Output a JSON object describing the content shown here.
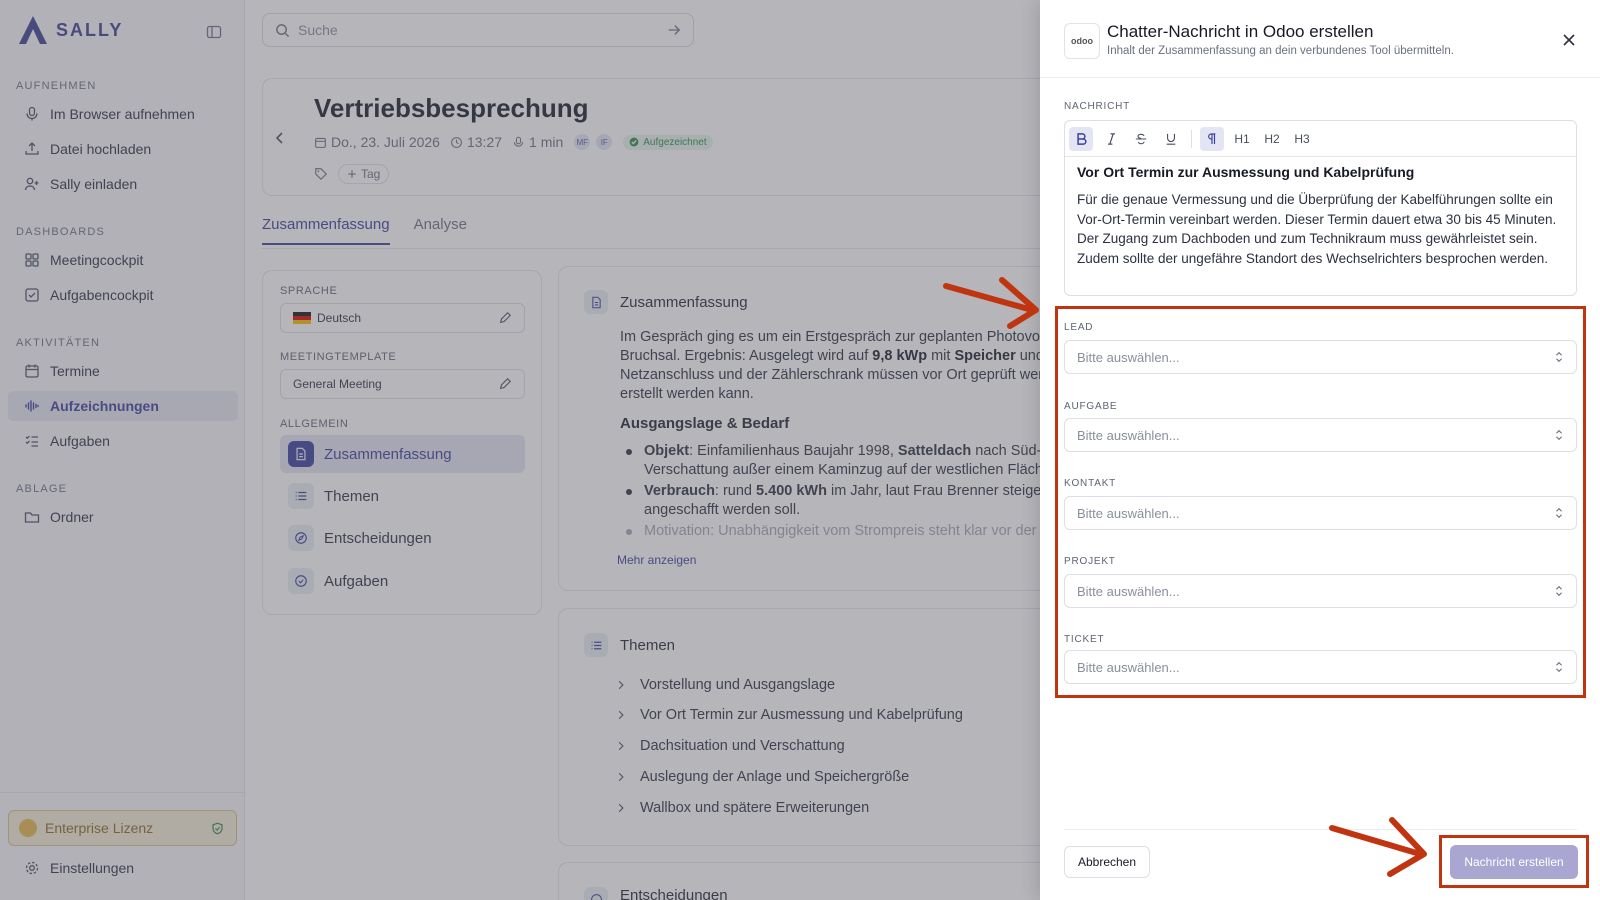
{
  "sidebar": {
    "brand": "SALLY",
    "sections": {
      "aufnehmen": "AUFNEHMEN",
      "dashboards": "DASHBOARDS",
      "aktivitaeten": "AKTIVITÄTEN",
      "ablage": "ABLAGE"
    },
    "items": {
      "record_browser": "Im Browser aufnehmen",
      "upload": "Datei hochladen",
      "invite": "Sally einladen",
      "meetingcockpit": "Meetingcockpit",
      "aufgabencockpit": "Aufgabencockpit",
      "termine": "Termine",
      "aufzeichnungen": "Aufzeichnungen",
      "aufgaben": "Aufgaben",
      "ordner": "Ordner"
    },
    "license": "Enterprise Lizenz",
    "settings": "Einstellungen"
  },
  "search": {
    "placeholder": "Suche"
  },
  "meeting": {
    "title": "Vertriebsbesprechung",
    "date": "Do., 23. Juli 2026",
    "time": "13:27",
    "duration": "1 min",
    "avatars": [
      "MF",
      "IF"
    ],
    "status": "Aufgezeichnet",
    "add_tag": "Tag"
  },
  "tabs": {
    "summary": "Zusammenfassung",
    "analysis": "Analyse"
  },
  "left_panel": {
    "language_label": "SPRACHE",
    "language": "Deutsch",
    "template_label": "MEETINGTEMPLATE",
    "template": "General Meeting",
    "general_label": "ALLGEMEIN",
    "nav": {
      "summary": "Zusammenfassung",
      "themes": "Themen",
      "decisions": "Entscheidungen",
      "tasks": "Aufgaben"
    }
  },
  "summary": {
    "heading": "Zusammenfassung",
    "p1_a": "Im Gespräch ging es um ein Erstgespräch zur geplanten Photovoltaik",
    "p1_b": "Bruchsal. Ergebnis: Ausgelegt wird auf ",
    "p1_kwp": "9,8 kWp",
    "p1_c": " mit ",
    "p1_speicher": "Speicher",
    "p1_d": " und Vo",
    "p1_e": "Netzanschluss und der Zählerschrank müssen vor Ort geprüft werde",
    "p1_f": "erstellt werden kann.",
    "sub_heading": "Ausgangslage & Bedarf",
    "b1_label": "Objekt",
    "b1_a": ": Einfamilienhaus Baujahr 1998, ",
    "b1_roof": "Satteldach",
    "b1_b": " nach Süd-Wes",
    "b1_c": "Verschattung außer einem Kaminzug auf der westlichen Fläche (",
    "b2_label": "Verbrauch",
    "b2_a": ": rund ",
    "b2_kwh": "5.400 kWh",
    "b2_b": " im Jahr, laut Frau Brenner steigend, d",
    "b2_c": "angeschafft werden soll.",
    "b3_label": "Motivation",
    "b3_a": ": Unabhängigkeit vom Strompreis steht klar vor der re",
    "more": "Mehr anzeigen"
  },
  "themes": {
    "heading": "Themen",
    "items": [
      "Vorstellung und Ausgangslage",
      "Vor Ort Termin zur Ausmessung und Kabelprüfung",
      "Dachsituation und Verschattung",
      "Auslegung der Anlage und Speichergröße",
      "Wallbox und spätere Erweiterungen"
    ]
  },
  "decisions": {
    "heading": "Entscheidungen"
  },
  "drawer": {
    "logo_text": "odoo",
    "title": "Chatter-Nachricht in Odoo erstellen",
    "subtitle": "Inhalt der Zusammenfassung an dein verbundenes Tool übermitteln.",
    "message_label": "NACHRICHT",
    "toolbar": {
      "h1": "H1",
      "h2": "H2",
      "h3": "H3"
    },
    "editor_heading": "Vor Ort Termin zur Ausmessung und Kabelprüfung",
    "editor_body": "Für die genaue Vermessung und die Überprüfung der Kabelführungen sollte ein Vor-Ort-Termin vereinbart werden. Dieser Termin dauert etwa 30 bis 45 Minuten. Der Zugang zum Dachboden und zum Technikraum muss gewährleistet sein. Zudem sollte der ungefähre Standort des Wechselrichters besprochen werden.",
    "fields": [
      {
        "label": "LEAD",
        "placeholder": "Bitte auswählen..."
      },
      {
        "label": "AUFGABE",
        "placeholder": "Bitte auswählen..."
      },
      {
        "label": "KONTAKT",
        "placeholder": "Bitte auswählen..."
      },
      {
        "label": "PROJEKT",
        "placeholder": "Bitte auswählen..."
      },
      {
        "label": "TICKET",
        "placeholder": "Bitte auswählen..."
      }
    ],
    "cancel": "Abbrechen",
    "submit": "Nachricht erstellen"
  },
  "colors": {
    "accent": "#3a3f9c",
    "annotation": "#c0350f",
    "submit_disabled": "#a9a6d2",
    "license": "#e5b84b"
  }
}
